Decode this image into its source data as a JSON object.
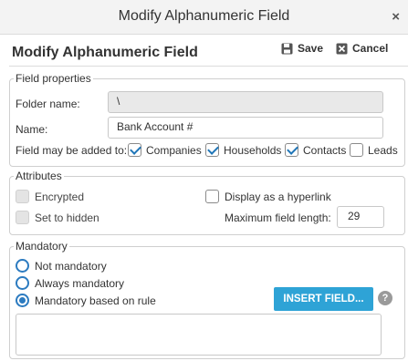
{
  "dialog": {
    "window_title": "Modify Alphanumeric Field",
    "close_glyph": "×",
    "heading": "Modify Alphanumeric Field",
    "save_label": "Save",
    "cancel_label": "Cancel"
  },
  "field_properties": {
    "legend": "Field properties",
    "folder_name_label": "Folder name:",
    "folder_name_value": "\\",
    "name_label": "Name:",
    "name_value": "Bank Account #",
    "added_to_label": "Field may be added to:",
    "targets": [
      {
        "label": "Companies",
        "checked": true
      },
      {
        "label": "Households",
        "checked": true
      },
      {
        "label": "Contacts",
        "checked": true
      },
      {
        "label": "Leads",
        "checked": false
      }
    ]
  },
  "attributes": {
    "legend": "Attributes",
    "encrypted_label": "Encrypted",
    "encrypted_checked": false,
    "hidden_label": "Set to hidden",
    "hidden_checked": false,
    "hyperlink_label": "Display as a hyperlink",
    "hyperlink_checked": false,
    "max_length_label": "Maximum field length:",
    "max_length_value": "29"
  },
  "mandatory": {
    "legend": "Mandatory",
    "options": [
      {
        "label": "Not mandatory",
        "selected": false
      },
      {
        "label": "Always mandatory",
        "selected": false
      },
      {
        "label": "Mandatory based on rule",
        "selected": true
      }
    ],
    "insert_field_label": "INSERT FIELD...",
    "help_glyph": "?",
    "rule_value": ""
  },
  "icons": {
    "save": "floppy-disk-icon",
    "cancel": "close-box-icon",
    "help": "question-circle-icon"
  },
  "colors": {
    "accent": "#2ea3d6",
    "checkmark": "#1f76b8",
    "radio": "#2c7bc0"
  }
}
